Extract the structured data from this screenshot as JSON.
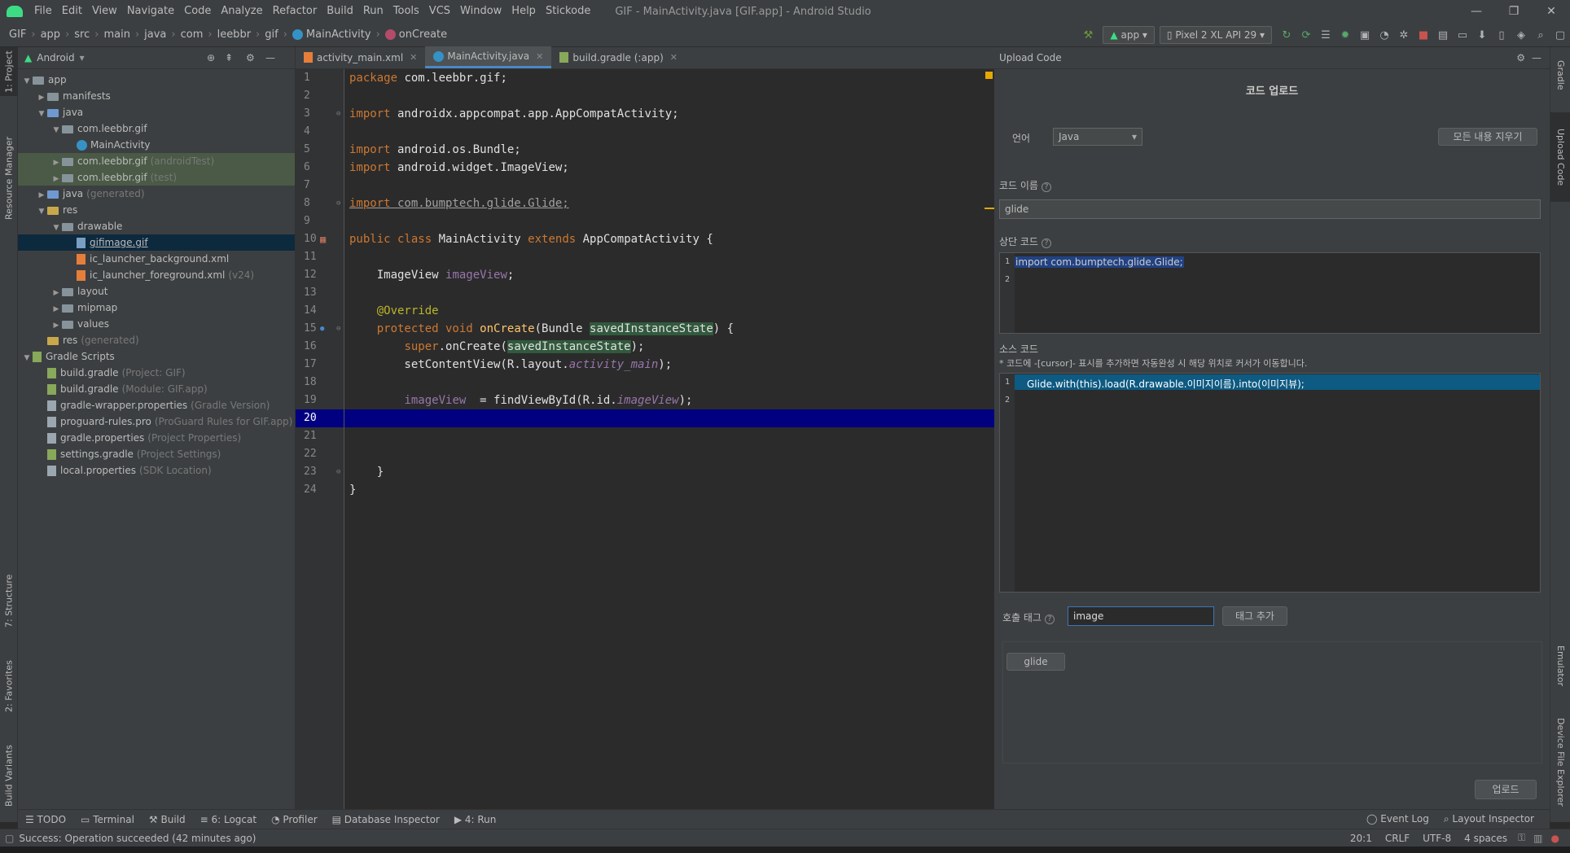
{
  "window": {
    "title": "GIF - MainActivity.java [GIF.app] - Android Studio",
    "menu": [
      "File",
      "Edit",
      "View",
      "Navigate",
      "Code",
      "Analyze",
      "Refactor",
      "Build",
      "Run",
      "Tools",
      "VCS",
      "Window",
      "Help",
      "Stickode"
    ]
  },
  "breadcrumb": [
    "GIF",
    "app",
    "src",
    "main",
    "java",
    "com",
    "leebbr",
    "gif",
    "MainActivity",
    "onCreate"
  ],
  "toolbar": {
    "config": "app",
    "device": "Pixel 2 XL API 29"
  },
  "left_tool_tabs": [
    "1: Project",
    "Resource Manager",
    "7: Structure",
    "2: Favorites",
    "Build Variants"
  ],
  "right_tool_tabs": [
    "Gradle",
    "Upload Code",
    "Emulator",
    "Device File Explorer"
  ],
  "project": {
    "view": "Android",
    "tree": [
      {
        "indent": 0,
        "arrow": "▼",
        "icon": "folder",
        "name": "app",
        "hint": ""
      },
      {
        "indent": 1,
        "arrow": "▶",
        "icon": "folder",
        "name": "manifests",
        "hint": ""
      },
      {
        "indent": 1,
        "arrow": "▼",
        "icon": "folder",
        "name": "java",
        "hint": ""
      },
      {
        "indent": 2,
        "arrow": "▼",
        "icon": "folder",
        "name": "com.leebbr.gif",
        "hint": ""
      },
      {
        "indent": 3,
        "arrow": "",
        "icon": "class",
        "name": "MainActivity",
        "hint": ""
      },
      {
        "indent": 2,
        "arrow": "▶",
        "icon": "folder",
        "name": "com.leebbr.gif",
        "hint": "(androidTest)",
        "hl": true
      },
      {
        "indent": 2,
        "arrow": "▶",
        "icon": "folder",
        "name": "com.leebbr.gif",
        "hint": "(test)",
        "hl": true
      },
      {
        "indent": 1,
        "arrow": "▶",
        "icon": "folder",
        "name": "java",
        "hint": "(generated)"
      },
      {
        "indent": 1,
        "arrow": "▼",
        "icon": "folder",
        "name": "res",
        "hint": ""
      },
      {
        "indent": 2,
        "arrow": "▼",
        "icon": "folder",
        "name": "drawable",
        "hint": ""
      },
      {
        "indent": 3,
        "arrow": "",
        "icon": "img",
        "name": "gifimage.gif",
        "hint": "",
        "sel": true
      },
      {
        "indent": 3,
        "arrow": "",
        "icon": "xml",
        "name": "ic_launcher_background.xml",
        "hint": ""
      },
      {
        "indent": 3,
        "arrow": "",
        "icon": "xml",
        "name": "ic_launcher_foreground.xml",
        "hint": "(v24)"
      },
      {
        "indent": 2,
        "arrow": "▶",
        "icon": "folder",
        "name": "layout",
        "hint": ""
      },
      {
        "indent": 2,
        "arrow": "▶",
        "icon": "folder",
        "name": "mipmap",
        "hint": ""
      },
      {
        "indent": 2,
        "arrow": "▶",
        "icon": "folder",
        "name": "values",
        "hint": ""
      },
      {
        "indent": 1,
        "arrow": "",
        "icon": "folder",
        "name": "res",
        "hint": "(generated)"
      },
      {
        "indent": 0,
        "arrow": "▼",
        "icon": "gradle",
        "name": "Gradle Scripts",
        "hint": ""
      },
      {
        "indent": 1,
        "arrow": "",
        "icon": "gradle",
        "name": "build.gradle",
        "hint": "(Project: GIF)"
      },
      {
        "indent": 1,
        "arrow": "",
        "icon": "gradle",
        "name": "build.gradle",
        "hint": "(Module: GIF.app)"
      },
      {
        "indent": 1,
        "arrow": "",
        "icon": "file",
        "name": "gradle-wrapper.properties",
        "hint": "(Gradle Version)"
      },
      {
        "indent": 1,
        "arrow": "",
        "icon": "file",
        "name": "proguard-rules.pro",
        "hint": "(ProGuard Rules for GIF.app)"
      },
      {
        "indent": 1,
        "arrow": "",
        "icon": "file",
        "name": "gradle.properties",
        "hint": "(Project Properties)"
      },
      {
        "indent": 1,
        "arrow": "",
        "icon": "gradle",
        "name": "settings.gradle",
        "hint": "(Project Settings)"
      },
      {
        "indent": 1,
        "arrow": "",
        "icon": "file",
        "name": "local.properties",
        "hint": "(SDK Location)"
      }
    ]
  },
  "editor": {
    "tabs": [
      {
        "label": "activity_main.xml",
        "active": false
      },
      {
        "label": "MainActivity.java",
        "active": true
      },
      {
        "label": "build.gradle (:app)",
        "active": false
      }
    ],
    "current_line": 20,
    "lines": [
      "<span class='kw'>package</span> com.leebbr.gif;",
      "",
      "<span class='kw'>import</span> androidx.appcompat.app.AppCompatActivity;",
      "",
      "<span class='kw'>import</span> android.os.Bundle;",
      "<span class='kw'>import</span> android.widget.ImageView;",
      "",
      "<span class='und'><span class='kw'>import</span> com.bumptech.glide.Glide;</span>",
      "",
      "<span class='kw'>public class</span> MainActivity <span class='kw'>extends</span> AppCompatActivity {",
      "",
      "    ImageView <span class='pf'>imageView</span>;",
      "",
      "    <span class='ann'>@Override</span>",
      "    <span class='kw'>protected void</span> <span class='fn'>onCreate</span>(Bundle <span class='hl'>savedInstanceState</span>) {",
      "        <span class='kw'>super</span>.onCreate(<span class='hl'>savedInstanceState</span>);",
      "        setContentView(R.layout.<span class='it'>activity_main</span>);",
      "",
      "        <span class='pf'>imageView</span>  = findViewById(R.id.<span class='it'>imageView</span>);",
      "",
      "",
      "",
      "    }",
      "}"
    ]
  },
  "upload_panel": {
    "header": "Upload Code",
    "title": "코드 업로드",
    "language_label": "언어",
    "language_value": "Java",
    "clear_all_button": "모든 내용 지우기",
    "code_name_label": "코드 이름",
    "code_name_value": "glide",
    "top_code_label": "상단 코드",
    "top_code_line": "import com.bumptech.glide.Glide;",
    "source_code_label": "소스 코드",
    "source_code_hint": "* 코드에 -[cursor]- 표시를 추가하면 자동완성 시 해당 위치로 커서가 이동합니다.",
    "source_code_line": "Glide.with(this).load(R.drawable.이미지이름).into(이미지뷰);",
    "call_tag_label": "호출 태그",
    "call_tag_input": "image",
    "add_tag_button": "태그 추가",
    "tags": [
      "glide"
    ],
    "upload_button": "업로드"
  },
  "bottom_tools": [
    "TODO",
    "Terminal",
    "Build",
    "6: Logcat",
    "Profiler",
    "Database Inspector",
    "4: Run"
  ],
  "bottom_tools_right": [
    "Event Log",
    "Layout Inspector"
  ],
  "status": {
    "message": "Success: Operation succeeded (42 minutes ago)",
    "position": "20:1",
    "line_sep": "CRLF",
    "encoding": "UTF-8",
    "indent": "4 spaces"
  }
}
